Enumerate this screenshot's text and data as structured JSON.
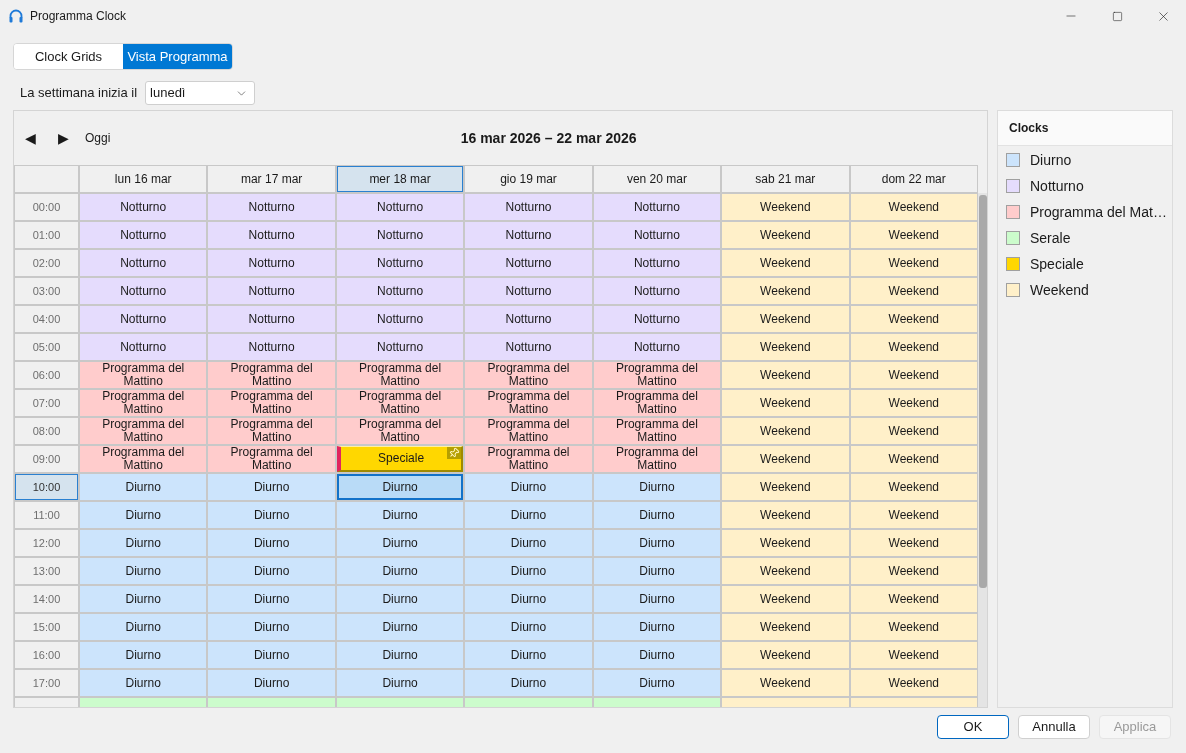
{
  "window": {
    "title": "Programma Clock"
  },
  "tabs": [
    {
      "label": "Clock Grids",
      "selected": false
    },
    {
      "label": "Vista Programma",
      "selected": true
    }
  ],
  "week_start": {
    "label": "La settimana inizia il",
    "value": "lunedì"
  },
  "calendar": {
    "nav": {
      "prev": "◀",
      "next": "▶",
      "today": "Oggi"
    },
    "range_title": "16 mar 2026 – 22 mar 2026",
    "columns": [
      {
        "label": "lun 16 mar",
        "selected": false
      },
      {
        "label": "mar 17 mar",
        "selected": false
      },
      {
        "label": "mer 18 mar",
        "selected": true
      },
      {
        "label": "gio 19 mar",
        "selected": false
      },
      {
        "label": "ven 20 mar",
        "selected": false
      },
      {
        "label": "sab 21 mar",
        "selected": false
      },
      {
        "label": "dom 22 mar",
        "selected": false
      }
    ],
    "rows": [
      {
        "time": "00:00",
        "selected": false,
        "cells": [
          {
            "label": "Notturno",
            "color": "#e5dcfd",
            "kind": "clock",
            "selected": false
          },
          {
            "label": "Notturno",
            "color": "#e5dcfd",
            "kind": "clock",
            "selected": false
          },
          {
            "label": "Notturno",
            "color": "#e5dcfd",
            "kind": "clock",
            "selected": false
          },
          {
            "label": "Notturno",
            "color": "#e5dcfd",
            "kind": "clock",
            "selected": false
          },
          {
            "label": "Notturno",
            "color": "#e5dcfd",
            "kind": "clock",
            "selected": false
          },
          {
            "label": "Weekend",
            "color": "#fff0c9",
            "kind": "clock",
            "selected": false
          },
          {
            "label": "Weekend",
            "color": "#fff0c9",
            "kind": "clock",
            "selected": false
          }
        ]
      },
      {
        "time": "01:00",
        "selected": false,
        "cells": [
          {
            "label": "Notturno",
            "color": "#e5dcfd",
            "kind": "clock",
            "selected": false
          },
          {
            "label": "Notturno",
            "color": "#e5dcfd",
            "kind": "clock",
            "selected": false
          },
          {
            "label": "Notturno",
            "color": "#e5dcfd",
            "kind": "clock",
            "selected": false
          },
          {
            "label": "Notturno",
            "color": "#e5dcfd",
            "kind": "clock",
            "selected": false
          },
          {
            "label": "Notturno",
            "color": "#e5dcfd",
            "kind": "clock",
            "selected": false
          },
          {
            "label": "Weekend",
            "color": "#fff0c9",
            "kind": "clock",
            "selected": false
          },
          {
            "label": "Weekend",
            "color": "#fff0c9",
            "kind": "clock",
            "selected": false
          }
        ]
      },
      {
        "time": "02:00",
        "selected": false,
        "cells": [
          {
            "label": "Notturno",
            "color": "#e5dcfd",
            "kind": "clock",
            "selected": false
          },
          {
            "label": "Notturno",
            "color": "#e5dcfd",
            "kind": "clock",
            "selected": false
          },
          {
            "label": "Notturno",
            "color": "#e5dcfd",
            "kind": "clock",
            "selected": false
          },
          {
            "label": "Notturno",
            "color": "#e5dcfd",
            "kind": "clock",
            "selected": false
          },
          {
            "label": "Notturno",
            "color": "#e5dcfd",
            "kind": "clock",
            "selected": false
          },
          {
            "label": "Weekend",
            "color": "#fff0c9",
            "kind": "clock",
            "selected": false
          },
          {
            "label": "Weekend",
            "color": "#fff0c9",
            "kind": "clock",
            "selected": false
          }
        ]
      },
      {
        "time": "03:00",
        "selected": false,
        "cells": [
          {
            "label": "Notturno",
            "color": "#e5dcfd",
            "kind": "clock",
            "selected": false
          },
          {
            "label": "Notturno",
            "color": "#e5dcfd",
            "kind": "clock",
            "selected": false
          },
          {
            "label": "Notturno",
            "color": "#e5dcfd",
            "kind": "clock",
            "selected": false
          },
          {
            "label": "Notturno",
            "color": "#e5dcfd",
            "kind": "clock",
            "selected": false
          },
          {
            "label": "Notturno",
            "color": "#e5dcfd",
            "kind": "clock",
            "selected": false
          },
          {
            "label": "Weekend",
            "color": "#fff0c9",
            "kind": "clock",
            "selected": false
          },
          {
            "label": "Weekend",
            "color": "#fff0c9",
            "kind": "clock",
            "selected": false
          }
        ]
      },
      {
        "time": "04:00",
        "selected": false,
        "cells": [
          {
            "label": "Notturno",
            "color": "#e5dcfd",
            "kind": "clock",
            "selected": false
          },
          {
            "label": "Notturno",
            "color": "#e5dcfd",
            "kind": "clock",
            "selected": false
          },
          {
            "label": "Notturno",
            "color": "#e5dcfd",
            "kind": "clock",
            "selected": false
          },
          {
            "label": "Notturno",
            "color": "#e5dcfd",
            "kind": "clock",
            "selected": false
          },
          {
            "label": "Notturno",
            "color": "#e5dcfd",
            "kind": "clock",
            "selected": false
          },
          {
            "label": "Weekend",
            "color": "#fff0c9",
            "kind": "clock",
            "selected": false
          },
          {
            "label": "Weekend",
            "color": "#fff0c9",
            "kind": "clock",
            "selected": false
          }
        ]
      },
      {
        "time": "05:00",
        "selected": false,
        "cells": [
          {
            "label": "Notturno",
            "color": "#e5dcfd",
            "kind": "clock",
            "selected": false
          },
          {
            "label": "Notturno",
            "color": "#e5dcfd",
            "kind": "clock",
            "selected": false
          },
          {
            "label": "Notturno",
            "color": "#e5dcfd",
            "kind": "clock",
            "selected": false
          },
          {
            "label": "Notturno",
            "color": "#e5dcfd",
            "kind": "clock",
            "selected": false
          },
          {
            "label": "Notturno",
            "color": "#e5dcfd",
            "kind": "clock",
            "selected": false
          },
          {
            "label": "Weekend",
            "color": "#fff0c9",
            "kind": "clock",
            "selected": false
          },
          {
            "label": "Weekend",
            "color": "#fff0c9",
            "kind": "clock",
            "selected": false
          }
        ]
      },
      {
        "time": "06:00",
        "selected": false,
        "cells": [
          {
            "label": "Programma del Mattino",
            "color": "#ffcccc",
            "kind": "clock",
            "selected": false
          },
          {
            "label": "Programma del Mattino",
            "color": "#ffcccc",
            "kind": "clock",
            "selected": false
          },
          {
            "label": "Programma del Mattino",
            "color": "#ffcccc",
            "kind": "clock",
            "selected": false
          },
          {
            "label": "Programma del Mattino",
            "color": "#ffcccc",
            "kind": "clock",
            "selected": false
          },
          {
            "label": "Programma del Mattino",
            "color": "#ffcccc",
            "kind": "clock",
            "selected": false
          },
          {
            "label": "Weekend",
            "color": "#fff0c9",
            "kind": "clock",
            "selected": false
          },
          {
            "label": "Weekend",
            "color": "#fff0c9",
            "kind": "clock",
            "selected": false
          }
        ]
      },
      {
        "time": "07:00",
        "selected": false,
        "cells": [
          {
            "label": "Programma del Mattino",
            "color": "#ffcccc",
            "kind": "clock",
            "selected": false
          },
          {
            "label": "Programma del Mattino",
            "color": "#ffcccc",
            "kind": "clock",
            "selected": false
          },
          {
            "label": "Programma del Mattino",
            "color": "#ffcccc",
            "kind": "clock",
            "selected": false
          },
          {
            "label": "Programma del Mattino",
            "color": "#ffcccc",
            "kind": "clock",
            "selected": false
          },
          {
            "label": "Programma del Mattino",
            "color": "#ffcccc",
            "kind": "clock",
            "selected": false
          },
          {
            "label": "Weekend",
            "color": "#fff0c9",
            "kind": "clock",
            "selected": false
          },
          {
            "label": "Weekend",
            "color": "#fff0c9",
            "kind": "clock",
            "selected": false
          }
        ]
      },
      {
        "time": "08:00",
        "selected": false,
        "cells": [
          {
            "label": "Programma del Mattino",
            "color": "#ffcccc",
            "kind": "clock",
            "selected": false
          },
          {
            "label": "Programma del Mattino",
            "color": "#ffcccc",
            "kind": "clock",
            "selected": false
          },
          {
            "label": "Programma del Mattino",
            "color": "#ffcccc",
            "kind": "clock",
            "selected": false
          },
          {
            "label": "Programma del Mattino",
            "color": "#ffcccc",
            "kind": "clock",
            "selected": false
          },
          {
            "label": "Programma del Mattino",
            "color": "#ffcccc",
            "kind": "clock",
            "selected": false
          },
          {
            "label": "Weekend",
            "color": "#fff0c9",
            "kind": "clock",
            "selected": false
          },
          {
            "label": "Weekend",
            "color": "#fff0c9",
            "kind": "clock",
            "selected": false
          }
        ]
      },
      {
        "time": "09:00",
        "selected": false,
        "cells": [
          {
            "label": "Programma del Mattino",
            "color": "#ffcccc",
            "kind": "clock",
            "selected": false
          },
          {
            "label": "Programma del Mattino",
            "color": "#ffcccc",
            "kind": "clock",
            "selected": false
          },
          {
            "label": "Speciale",
            "color": "#ffd700",
            "kind": "override",
            "selected": false
          },
          {
            "label": "Programma del Mattino",
            "color": "#ffcccc",
            "kind": "clock",
            "selected": false
          },
          {
            "label": "Programma del Mattino",
            "color": "#ffcccc",
            "kind": "clock",
            "selected": false
          },
          {
            "label": "Weekend",
            "color": "#fff0c9",
            "kind": "clock",
            "selected": false
          },
          {
            "label": "Weekend",
            "color": "#fff0c9",
            "kind": "clock",
            "selected": false
          }
        ]
      },
      {
        "time": "10:00",
        "selected": true,
        "cells": [
          {
            "label": "Diurno",
            "color": "#cce4fc",
            "kind": "clock",
            "selected": false
          },
          {
            "label": "Diurno",
            "color": "#cce4fc",
            "kind": "clock",
            "selected": false
          },
          {
            "label": "Diurno",
            "color": "#b9dbf7",
            "kind": "clock",
            "selected": true
          },
          {
            "label": "Diurno",
            "color": "#cce4fc",
            "kind": "clock",
            "selected": false
          },
          {
            "label": "Diurno",
            "color": "#cce4fc",
            "kind": "clock",
            "selected": false
          },
          {
            "label": "Weekend",
            "color": "#fff0c9",
            "kind": "clock",
            "selected": false
          },
          {
            "label": "Weekend",
            "color": "#fff0c9",
            "kind": "clock",
            "selected": false
          }
        ]
      },
      {
        "time": "11:00",
        "selected": false,
        "cells": [
          {
            "label": "Diurno",
            "color": "#cce4fc",
            "kind": "clock",
            "selected": false
          },
          {
            "label": "Diurno",
            "color": "#cce4fc",
            "kind": "clock",
            "selected": false
          },
          {
            "label": "Diurno",
            "color": "#cce4fc",
            "kind": "clock",
            "selected": false
          },
          {
            "label": "Diurno",
            "color": "#cce4fc",
            "kind": "clock",
            "selected": false
          },
          {
            "label": "Diurno",
            "color": "#cce4fc",
            "kind": "clock",
            "selected": false
          },
          {
            "label": "Weekend",
            "color": "#fff0c9",
            "kind": "clock",
            "selected": false
          },
          {
            "label": "Weekend",
            "color": "#fff0c9",
            "kind": "clock",
            "selected": false
          }
        ]
      },
      {
        "time": "12:00",
        "selected": false,
        "cells": [
          {
            "label": "Diurno",
            "color": "#cce4fc",
            "kind": "clock",
            "selected": false
          },
          {
            "label": "Diurno",
            "color": "#cce4fc",
            "kind": "clock",
            "selected": false
          },
          {
            "label": "Diurno",
            "color": "#cce4fc",
            "kind": "clock",
            "selected": false
          },
          {
            "label": "Diurno",
            "color": "#cce4fc",
            "kind": "clock",
            "selected": false
          },
          {
            "label": "Diurno",
            "color": "#cce4fc",
            "kind": "clock",
            "selected": false
          },
          {
            "label": "Weekend",
            "color": "#fff0c9",
            "kind": "clock",
            "selected": false
          },
          {
            "label": "Weekend",
            "color": "#fff0c9",
            "kind": "clock",
            "selected": false
          }
        ]
      },
      {
        "time": "13:00",
        "selected": false,
        "cells": [
          {
            "label": "Diurno",
            "color": "#cce4fc",
            "kind": "clock",
            "selected": false
          },
          {
            "label": "Diurno",
            "color": "#cce4fc",
            "kind": "clock",
            "selected": false
          },
          {
            "label": "Diurno",
            "color": "#cce4fc",
            "kind": "clock",
            "selected": false
          },
          {
            "label": "Diurno",
            "color": "#cce4fc",
            "kind": "clock",
            "selected": false
          },
          {
            "label": "Diurno",
            "color": "#cce4fc",
            "kind": "clock",
            "selected": false
          },
          {
            "label": "Weekend",
            "color": "#fff0c9",
            "kind": "clock",
            "selected": false
          },
          {
            "label": "Weekend",
            "color": "#fff0c9",
            "kind": "clock",
            "selected": false
          }
        ]
      },
      {
        "time": "14:00",
        "selected": false,
        "cells": [
          {
            "label": "Diurno",
            "color": "#cce4fc",
            "kind": "clock",
            "selected": false
          },
          {
            "label": "Diurno",
            "color": "#cce4fc",
            "kind": "clock",
            "selected": false
          },
          {
            "label": "Diurno",
            "color": "#cce4fc",
            "kind": "clock",
            "selected": false
          },
          {
            "label": "Diurno",
            "color": "#cce4fc",
            "kind": "clock",
            "selected": false
          },
          {
            "label": "Diurno",
            "color": "#cce4fc",
            "kind": "clock",
            "selected": false
          },
          {
            "label": "Weekend",
            "color": "#fff0c9",
            "kind": "clock",
            "selected": false
          },
          {
            "label": "Weekend",
            "color": "#fff0c9",
            "kind": "clock",
            "selected": false
          }
        ]
      },
      {
        "time": "15:00",
        "selected": false,
        "cells": [
          {
            "label": "Diurno",
            "color": "#cce4fc",
            "kind": "clock",
            "selected": false
          },
          {
            "label": "Diurno",
            "color": "#cce4fc",
            "kind": "clock",
            "selected": false
          },
          {
            "label": "Diurno",
            "color": "#cce4fc",
            "kind": "clock",
            "selected": false
          },
          {
            "label": "Diurno",
            "color": "#cce4fc",
            "kind": "clock",
            "selected": false
          },
          {
            "label": "Diurno",
            "color": "#cce4fc",
            "kind": "clock",
            "selected": false
          },
          {
            "label": "Weekend",
            "color": "#fff0c9",
            "kind": "clock",
            "selected": false
          },
          {
            "label": "Weekend",
            "color": "#fff0c9",
            "kind": "clock",
            "selected": false
          }
        ]
      },
      {
        "time": "16:00",
        "selected": false,
        "cells": [
          {
            "label": "Diurno",
            "color": "#cce4fc",
            "kind": "clock",
            "selected": false
          },
          {
            "label": "Diurno",
            "color": "#cce4fc",
            "kind": "clock",
            "selected": false
          },
          {
            "label": "Diurno",
            "color": "#cce4fc",
            "kind": "clock",
            "selected": false
          },
          {
            "label": "Diurno",
            "color": "#cce4fc",
            "kind": "clock",
            "selected": false
          },
          {
            "label": "Diurno",
            "color": "#cce4fc",
            "kind": "clock",
            "selected": false
          },
          {
            "label": "Weekend",
            "color": "#fff0c9",
            "kind": "clock",
            "selected": false
          },
          {
            "label": "Weekend",
            "color": "#fff0c9",
            "kind": "clock",
            "selected": false
          }
        ]
      },
      {
        "time": "17:00",
        "selected": false,
        "cells": [
          {
            "label": "Diurno",
            "color": "#cce4fc",
            "kind": "clock",
            "selected": false
          },
          {
            "label": "Diurno",
            "color": "#cce4fc",
            "kind": "clock",
            "selected": false
          },
          {
            "label": "Diurno",
            "color": "#cce4fc",
            "kind": "clock",
            "selected": false
          },
          {
            "label": "Diurno",
            "color": "#cce4fc",
            "kind": "clock",
            "selected": false
          },
          {
            "label": "Diurno",
            "color": "#cce4fc",
            "kind": "clock",
            "selected": false
          },
          {
            "label": "Weekend",
            "color": "#fff0c9",
            "kind": "clock",
            "selected": false
          },
          {
            "label": "Weekend",
            "color": "#fff0c9",
            "kind": "clock",
            "selected": false
          }
        ]
      },
      {
        "selected": false,
        "cells": [
          {
            "color": "#ccfccc",
            "kind": "clock",
            "selected": false
          },
          {
            "color": "#ccfccc",
            "kind": "clock",
            "selected": false
          },
          {
            "color": "#ccfccc",
            "kind": "clock",
            "selected": false
          },
          {
            "color": "#ccfccc",
            "kind": "clock",
            "selected": false
          },
          {
            "color": "#ccfccc",
            "kind": "clock",
            "selected": false
          },
          {
            "color": "#fff0c9",
            "kind": "clock",
            "selected": false
          },
          {
            "color": "#fff0c9",
            "kind": "clock",
            "selected": false
          }
        ]
      }
    ]
  },
  "legend": {
    "title": "Clocks",
    "items": [
      {
        "label": "Diurno",
        "color": "#cce4fc"
      },
      {
        "label": "Notturno",
        "color": "#e5dcfd"
      },
      {
        "label": "Programma del Mat…",
        "color": "#ffcccc"
      },
      {
        "label": "Serale",
        "color": "#ccfccc"
      },
      {
        "label": "Speciale",
        "color": "#ffd700"
      },
      {
        "label": "Weekend",
        "color": "#fff0c9"
      }
    ]
  },
  "buttons": [
    {
      "label": "OK",
      "default": true,
      "disabled": false
    },
    {
      "label": "Annulla",
      "default": false,
      "disabled": false
    },
    {
      "label": "Applica",
      "default": false,
      "disabled": true
    }
  ]
}
